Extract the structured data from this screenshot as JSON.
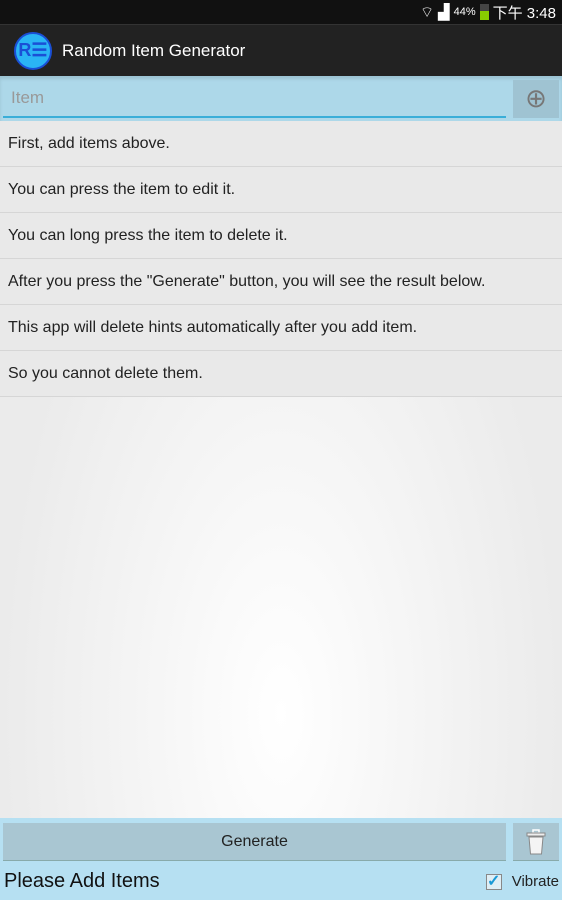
{
  "status_bar": {
    "battery": "44%",
    "time": "下午 3:48",
    "icons": [
      "wifi-icon",
      "signal-icon",
      "battery-icon"
    ]
  },
  "app": {
    "title": "Random Item Generator",
    "logo_letter": "R"
  },
  "input": {
    "placeholder": "Item",
    "value": ""
  },
  "hints": [
    "First, add items above.",
    "You can press the item to edit it.",
    "You can long press the item to delete it.",
    "After you press the \"Generate\" button, you will see the result below.",
    "This app will delete hints automatically after you add item.",
    "So you cannot delete them."
  ],
  "bottom": {
    "generate_label": "Generate",
    "result": "Please Add Items",
    "vibrate_label": "Vibrate",
    "vibrate_checked": true
  },
  "colors": {
    "accent": "#3aaed8",
    "panel": "#b6e0f2"
  }
}
